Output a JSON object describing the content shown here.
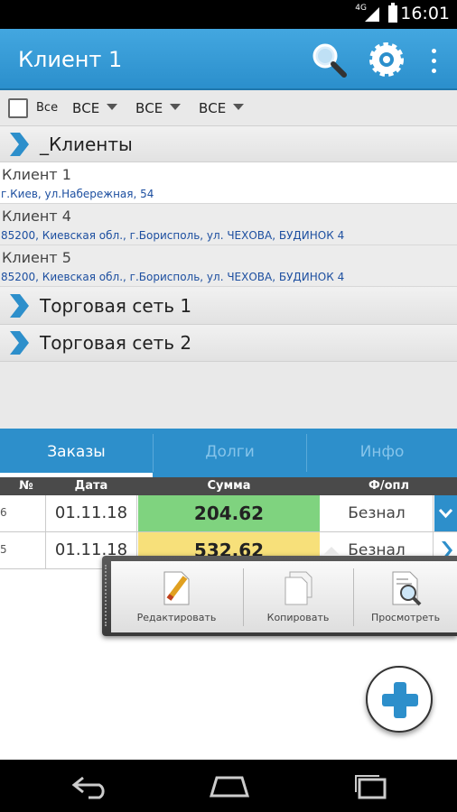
{
  "status_bar": {
    "time": "16:01",
    "network": "4G"
  },
  "action_bar": {
    "title": "Клиент 1",
    "icons": [
      "search-icon",
      "settings-icon",
      "overflow-menu-icon"
    ]
  },
  "filters": {
    "all_checkbox_label": "Все",
    "dropdowns": [
      "ВСЕ",
      "ВСЕ",
      "ВСЕ"
    ]
  },
  "list": {
    "groups": [
      {
        "label": "_Клиенты"
      },
      {
        "label": "Торговая сеть 1"
      },
      {
        "label": "Торговая сеть 2"
      }
    ],
    "clients": [
      {
        "name": "Клиент 1",
        "address": "г.Киев, ул.Набережная, 54",
        "selected": true
      },
      {
        "name": "Клиент 4",
        "address": "85200, Киевская обл., г.Борисполь, ул. ЧЕХОВА, БУДИНОК 4",
        "selected": false
      },
      {
        "name": "Клиент 5",
        "address": "85200, Киевская обл., г.Борисполь, ул. ЧЕХОВА, БУДИНОК 4",
        "selected": false
      }
    ]
  },
  "tabs": [
    {
      "label": "Заказы",
      "active": true
    },
    {
      "label": "Долги",
      "active": false
    },
    {
      "label": "Инфо",
      "active": false
    }
  ],
  "orders_table": {
    "headers": {
      "num": "№",
      "date": "Дата",
      "sum": "Сумма",
      "payment": "Ф/опл"
    },
    "rows": [
      {
        "num": "6",
        "date": "01.11.18",
        "sum": "204.62",
        "payment": "Безнал",
        "sum_color": "#7fd37f",
        "action_icon": "chevron-down-icon"
      },
      {
        "num": "5",
        "date": "01.11.18",
        "sum": "532.62",
        "payment": "Безнал",
        "sum_color": "#f7e07a",
        "action_icon": "chevron-right-icon"
      }
    ]
  },
  "context_popup": {
    "items": [
      {
        "label": "Редактировать",
        "icon": "edit-document-icon"
      },
      {
        "label": "Копировать",
        "icon": "copy-document-icon"
      },
      {
        "label": "Просмотреть",
        "icon": "view-document-icon"
      }
    ]
  },
  "fab": {
    "icon": "add-icon"
  },
  "nav_bar": {
    "icons": [
      "back-icon",
      "home-icon",
      "recent-apps-icon"
    ]
  },
  "colors": {
    "accent": "#2d8fcb",
    "paid_green": "#7fd37f",
    "pending_yellow": "#f7e07a"
  }
}
